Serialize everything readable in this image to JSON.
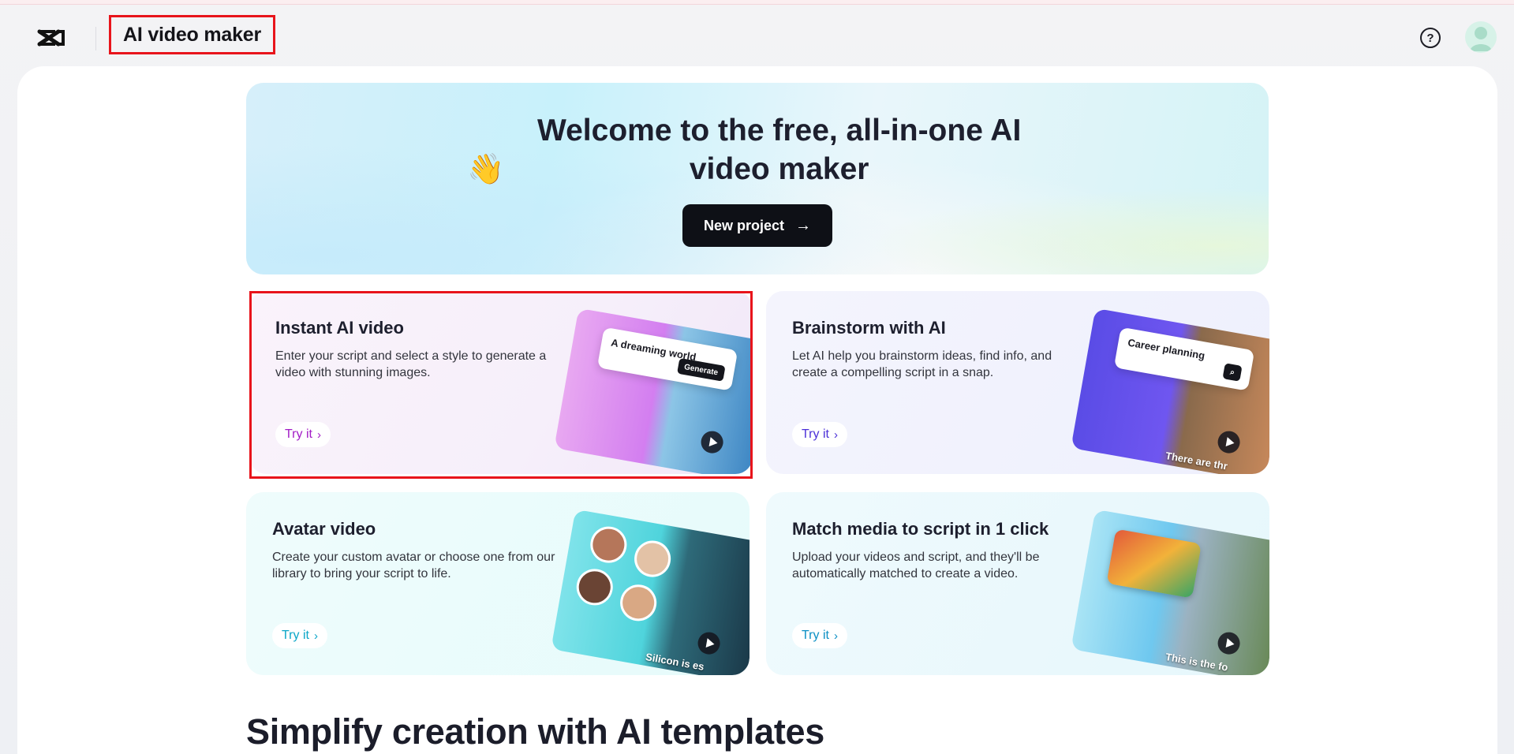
{
  "header": {
    "title": "AI video maker",
    "help_icon": "help-circle-icon",
    "help_glyph": "?",
    "avatar_icon": "user-avatar-icon",
    "logo_icon": "capcut-logo-icon"
  },
  "hero": {
    "emoji": "👋",
    "title": "Welcome to the free, all-in-one AI video maker",
    "button_label": "New project",
    "button_icon": "arrow-right-icon",
    "button_arrow": "→"
  },
  "features": [
    {
      "title": "Instant AI video",
      "description": "Enter your script and select a style to generate a video with stunning images.",
      "cta": "Try it",
      "thumb_prompt": "A dreaming world",
      "thumb_button": "Generate",
      "accent": "#a21cc6"
    },
    {
      "title": "Brainstorm with AI",
      "description": "Let AI help you brainstorm ideas, find info, and create a compelling script in a snap.",
      "cta": "Try it",
      "thumb_prompt": "Career planning",
      "thumb_caption": "There are thr",
      "accent": "#4b30d8"
    },
    {
      "title": "Avatar video",
      "description": "Create your custom avatar or choose one from our library to bring your script to life.",
      "cta": "Try it",
      "thumb_caption": "Silicon is es",
      "accent": "#0aa6c8"
    },
    {
      "title": "Match media to script in 1 click",
      "description": "Upload your videos and script, and they'll be automatically matched to create a video.",
      "cta": "Try it",
      "thumb_caption": "This is the fo",
      "accent": "#0b8fc4"
    }
  ],
  "chevron": "›",
  "templates_section": {
    "title": "Simplify creation with AI templates"
  },
  "colors": {
    "highlight_border": "#e8141b",
    "primary_button": "#0e1016"
  }
}
